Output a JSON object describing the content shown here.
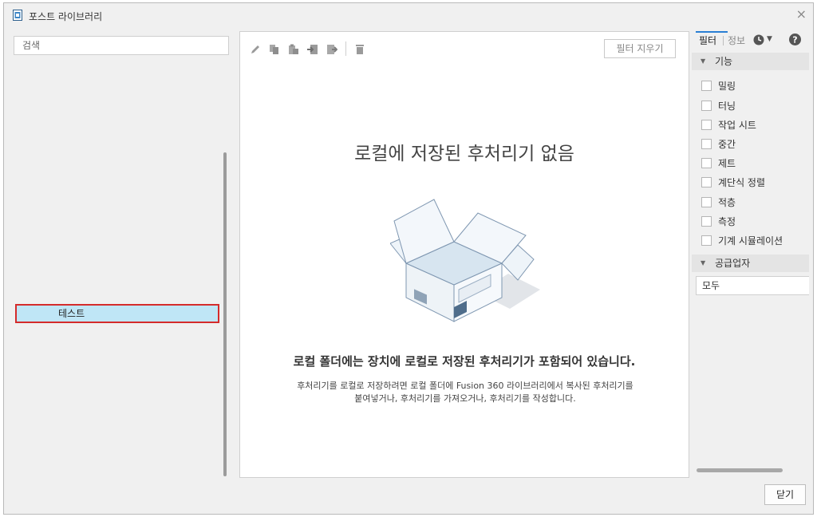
{
  "window": {
    "title": "포스트 라이브러리",
    "close_glyph": "×"
  },
  "left": {
    "search_placeholder": "검색",
    "tree_items": [
      "테스트"
    ]
  },
  "center": {
    "toolbar_icons": [
      "pencil-icon",
      "copy-icon",
      "paste-icon",
      "import-icon",
      "export-icon",
      "delete-icon"
    ],
    "clear_filter_label": "필터 지우기",
    "empty_title": "로컬에 저장된 후처리기 없음",
    "empty_heading": "로컬 폴더에는 장치에 로컬로 저장된 후처리기가 포함되어 있습니다.",
    "empty_desc_line1": "후처리기를 로컬로 저장하려면 로컬 폴더에 Fusion 360 라이브러리에서 복사된 후처리기를",
    "empty_desc_line2": "붙여넣거나, 후처리기를 가져오거나, 후처리기를 작성합니다."
  },
  "right": {
    "tab_filter": "필터",
    "tab_info": "정보",
    "section_function": "기능",
    "functions": [
      "밀링",
      "터닝",
      "작업 시트",
      "중간",
      "제트",
      "계단식 정렬",
      "적층",
      "측정",
      "기계 시뮬레이션"
    ],
    "section_vendor": "공급업자",
    "vendor_value": "모두"
  },
  "footer": {
    "close_label": "닫기"
  },
  "colors": {
    "accent_blue": "#2a7fd4",
    "selection_bg": "#bfe6f6",
    "selection_border": "#d42b2b"
  }
}
